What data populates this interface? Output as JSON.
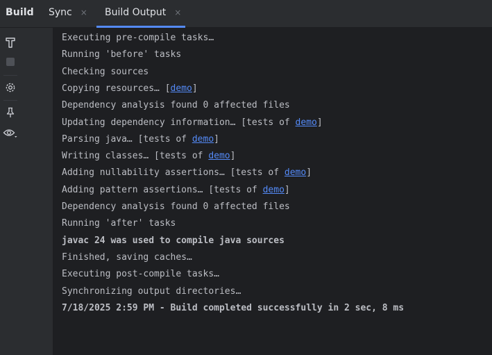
{
  "tabbar": {
    "title": "Build",
    "tabs": [
      {
        "label": "Sync",
        "close_glyph": "×"
      },
      {
        "label": "Build Output",
        "close_glyph": "×"
      }
    ]
  },
  "toolbar": {
    "icons": [
      "hammer-icon",
      "stop-icon",
      "settings-icon",
      "pin-icon",
      "eye-icon"
    ]
  },
  "console": {
    "lines": [
      {
        "text": "Executing pre-compile tasks…"
      },
      {
        "text": "Running 'before' tasks"
      },
      {
        "text": "Checking sources"
      },
      {
        "before": "Copying resources… [",
        "link": "demo",
        "after": "]"
      },
      {
        "text": "Dependency analysis found 0 affected files"
      },
      {
        "before": "Updating dependency information… [tests of ",
        "link": "demo",
        "after": "]"
      },
      {
        "before": "Parsing java… [tests of ",
        "link": "demo",
        "after": "]"
      },
      {
        "before": "Writing classes… [tests of ",
        "link": "demo",
        "after": "]"
      },
      {
        "before": "Adding nullability assertions… [tests of ",
        "link": "demo",
        "after": "]"
      },
      {
        "before": "Adding pattern assertions… [tests of ",
        "link": "demo",
        "after": "]"
      },
      {
        "text": "Dependency analysis found 0 affected files"
      },
      {
        "text": "Running 'after' tasks"
      },
      {
        "text": "javac 24 was used to compile java sources",
        "bold": true
      },
      {
        "text": "Finished, saving caches…"
      },
      {
        "text": "Executing post-compile tasks…"
      },
      {
        "text": "Synchronizing output directories…"
      },
      {
        "text": "7/18/2025 2:59 PM - Build completed successfully in 2 sec, 8 ms",
        "bold": true
      }
    ]
  },
  "colors": {
    "background": "#1e1f22",
    "panel": "#2b2d30",
    "text": "#bcbec4",
    "link": "#548af7",
    "accent": "#548af7"
  }
}
